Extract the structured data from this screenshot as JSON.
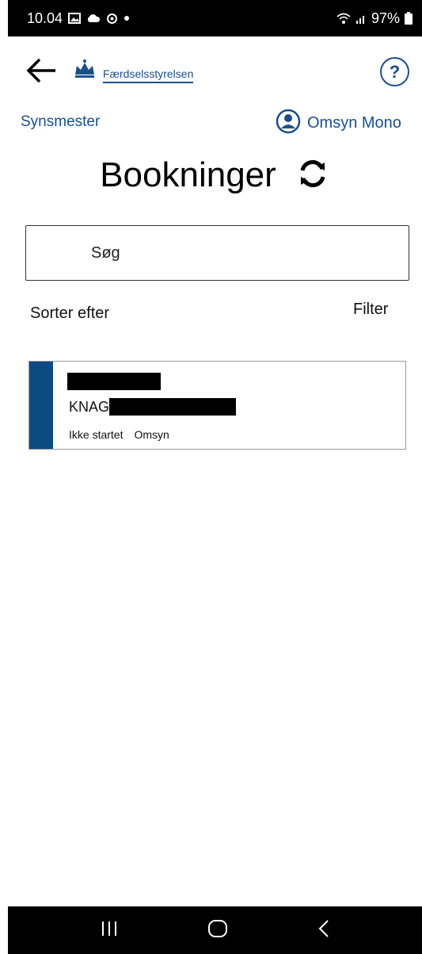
{
  "status_bar": {
    "time": "10.04",
    "battery": "97%"
  },
  "header": {
    "brand": "Færdselsstyrelsen",
    "help_icon": "?"
  },
  "subheader": {
    "role": "Synsmester",
    "user": "Omsyn Mono"
  },
  "page": {
    "title": "Bookninger"
  },
  "search": {
    "placeholder": "Søg"
  },
  "controls": {
    "sort_label": "Sorter efter",
    "filter_label": "Filter"
  },
  "bookings": [
    {
      "plate_prefix": "KNAG",
      "status": "Ikke startet",
      "type": "Omsyn"
    }
  ],
  "colors": {
    "brand_blue": "#1b4f8a",
    "accent": "#0d4a82"
  }
}
